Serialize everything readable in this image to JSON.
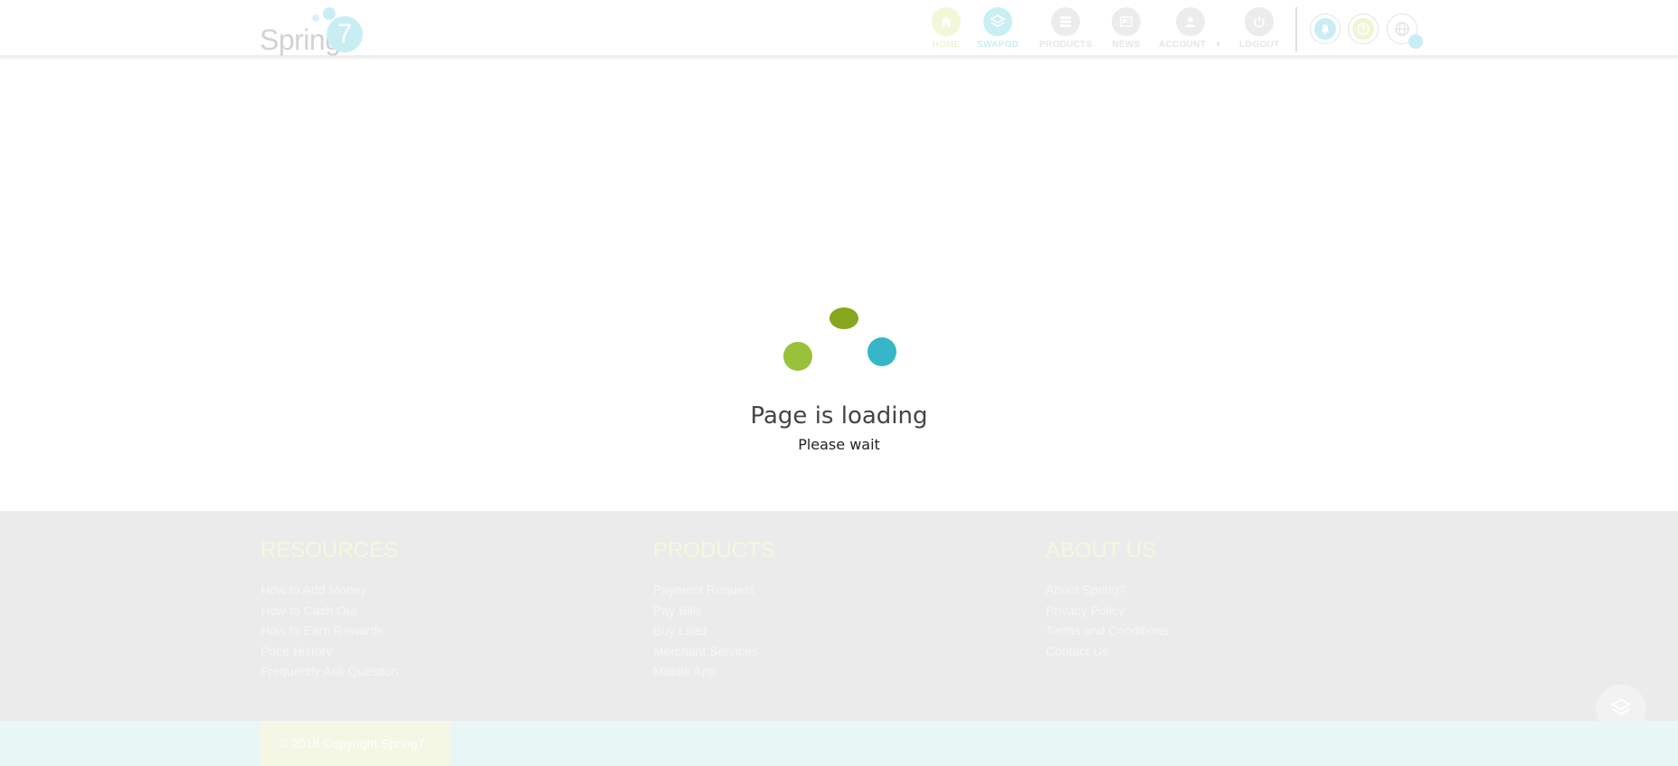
{
  "header": {
    "logo_text": "Spring",
    "logo_number": "7",
    "nav": [
      {
        "label": "HOME",
        "icon": "home-icon"
      },
      {
        "label": "SWAPOD",
        "icon": "swapod-icon"
      },
      {
        "label": "PRODUCTS",
        "icon": "products-grid-icon"
      },
      {
        "label": "NEWS",
        "icon": "news-icon"
      },
      {
        "label": "ACCOUNT",
        "icon": "user-icon"
      },
      {
        "label": "LOGOUT",
        "icon": "power-icon"
      }
    ],
    "utility_icons": [
      "bell-icon",
      "help-icon",
      "globe-icon"
    ]
  },
  "loader": {
    "title": "Page is loading",
    "subtitle": "Please wait",
    "colors": {
      "top": "#88a61d",
      "left": "#99c13a",
      "right": "#36b6c8"
    }
  },
  "footer": {
    "columns": [
      {
        "title": "RESOURCES",
        "links": [
          "How to Add Money",
          "How to Cash Out",
          "How to Earn Rewards",
          "Price History",
          "Frequently Ask Question"
        ]
      },
      {
        "title": "PRODUCTS",
        "links": [
          "Payment Request",
          "Pay Bills",
          "Buy Load",
          "Merchant Services",
          "Mobile App"
        ]
      },
      {
        "title": "ABOUT US",
        "links": [
          "About Spring7",
          "Privacy Policy",
          "Terms and Conditions",
          "Contact Us"
        ]
      }
    ],
    "copyright": "© 2018 Copyright Spring7"
  }
}
